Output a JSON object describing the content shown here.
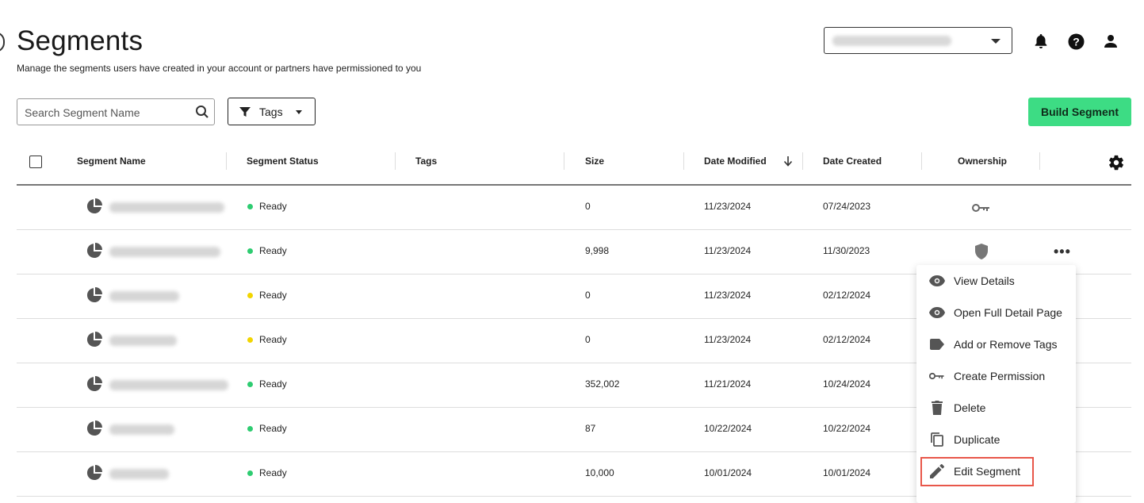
{
  "header": {
    "title": "Segments",
    "subtitle": "Manage the segments users have created in your account or partners have permissioned to you"
  },
  "account_select": {
    "icon": "chevron-down-icon"
  },
  "top_icons": [
    "bell-icon",
    "help-icon",
    "user-icon"
  ],
  "toolbar": {
    "search_placeholder": "Search Segment Name",
    "tags_label": "Tags",
    "build_label": "Build Segment"
  },
  "table": {
    "columns": {
      "name": "Segment Name",
      "status": "Segment Status",
      "tags": "Tags",
      "size": "Size",
      "modified": "Date Modified",
      "created": "Date Created",
      "ownership": "Ownership"
    },
    "rows": [
      {
        "status": "Ready",
        "status_color": "#2ecc71",
        "size": "0",
        "modified": "11/23/2024",
        "created": "07/24/2023",
        "ownership_icon": "key-icon"
      },
      {
        "status": "Ready",
        "status_color": "#2ecc71",
        "size": "9,998",
        "modified": "11/23/2024",
        "created": "11/30/2023",
        "ownership_icon": "shield-icon"
      },
      {
        "status": "Ready",
        "status_color": "#f2d500",
        "size": "0",
        "modified": "11/23/2024",
        "created": "02/12/2024"
      },
      {
        "status": "Ready",
        "status_color": "#f2d500",
        "size": "0",
        "modified": "11/23/2024",
        "created": "02/12/2024"
      },
      {
        "status": "Ready",
        "status_color": "#2ecc71",
        "size": "352,002",
        "modified": "11/21/2024",
        "created": "10/24/2024"
      },
      {
        "status": "Ready",
        "status_color": "#2ecc71",
        "size": "87",
        "modified": "10/22/2024",
        "created": "10/22/2024"
      },
      {
        "status": "Ready",
        "status_color": "#2ecc71",
        "size": "10,000",
        "modified": "10/01/2024",
        "created": "10/01/2024"
      }
    ]
  },
  "context_menu": {
    "items": [
      {
        "label": "View Details",
        "icon": "eye-icon"
      },
      {
        "label": "Open Full Detail Page",
        "icon": "eye-icon"
      },
      {
        "label": "Add or Remove Tags",
        "icon": "tag-icon"
      },
      {
        "label": "Create Permission",
        "icon": "key-icon"
      },
      {
        "label": "Delete",
        "icon": "trash-icon"
      },
      {
        "label": "Duplicate",
        "icon": "copy-icon"
      },
      {
        "label": "Edit Segment",
        "icon": "pencil-icon"
      }
    ],
    "highlighted": "Edit Segment",
    "highlight_color": "#e8574a"
  },
  "colors": {
    "accent": "#3ddc84",
    "ready_green": "#2ecc71",
    "ready_yellow": "#f2d500"
  }
}
